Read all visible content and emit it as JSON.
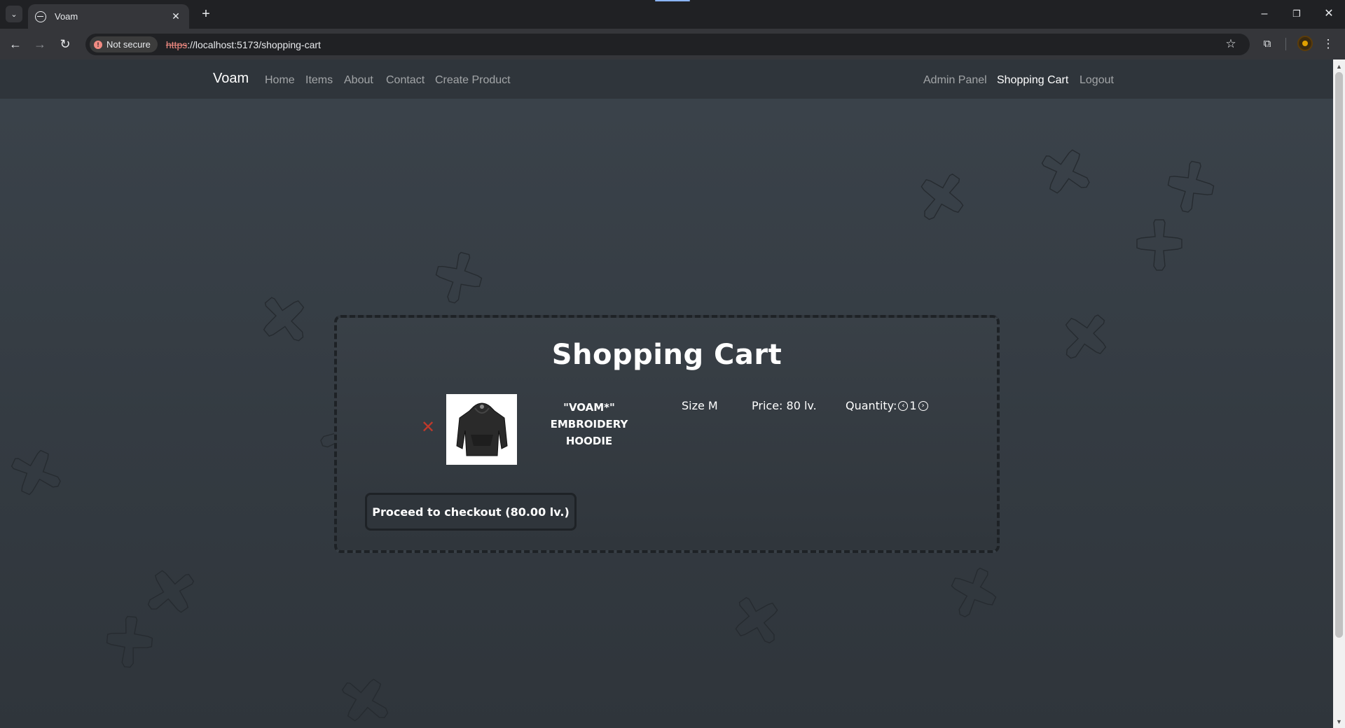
{
  "browser": {
    "tab_title": "Voam",
    "security_label": "Not secure",
    "url_scheme": "https",
    "url_rest": "://localhost:5173/shopping-cart"
  },
  "site": {
    "brand": "Voam",
    "nav_left": [
      "Home",
      "Items",
      "About",
      "Contact",
      "Create Product"
    ],
    "nav_right": [
      "Admin Panel",
      "Shopping Cart",
      "Logout"
    ],
    "active_item": "Shopping Cart"
  },
  "cart": {
    "title": "Shopping Cart",
    "remove_symbol": "✕",
    "item": {
      "name_line1": "\"VOAM*\"",
      "name_line2": "EMBROIDERY",
      "name_line3": "HOODIE",
      "size": "Size M",
      "price": "Price: 80 lv.",
      "quantity_label": "Quantity:",
      "quantity": "1"
    },
    "checkout_label": "Proceed to checkout (80.00 lv.)"
  },
  "colors": {
    "page_bg": "#3b434b",
    "navbar_bg": "#2f353b",
    "remove": "#c0392b"
  }
}
